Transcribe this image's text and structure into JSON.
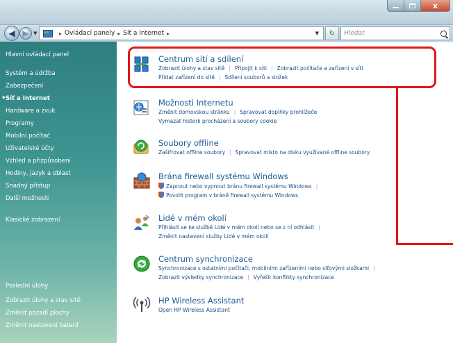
{
  "window": {
    "caption_buttons": {
      "minimize": "minimize",
      "maximize": "maximize",
      "close": "x"
    }
  },
  "navigation": {
    "address": {
      "segments": [
        "Ovládací panely",
        "Síť a Internet"
      ]
    },
    "search": {
      "placeholder": "Hledat"
    }
  },
  "sidebar": {
    "items": [
      {
        "label": "Hlavní ovládací panel"
      },
      {
        "label": "Systém a údržba"
      },
      {
        "label": "Zabezpečení"
      },
      {
        "label": "Síť a Internet",
        "current": true
      },
      {
        "label": "Hardware a zvuk"
      },
      {
        "label": "Programy"
      },
      {
        "label": "Mobilní počítač"
      },
      {
        "label": "Uživatelské účty"
      },
      {
        "label": "Vzhled a přizpůsobení"
      },
      {
        "label": "Hodiny, jazyk a oblast"
      },
      {
        "label": "Snadný přístup"
      },
      {
        "label": "Další možnosti"
      },
      {
        "label": "Klasické zobrazení"
      }
    ],
    "recent": {
      "heading": "Poslední úlohy",
      "items": [
        "Zobrazit úlohy a stav sítě",
        "Změnit pozadí plochy",
        "Změnit nastavení baterií"
      ]
    }
  },
  "categories": [
    {
      "title": "Centrum sítí a sdílení",
      "icon": "network-center-icon",
      "links": [
        [
          "Zobrazit úlohy a stav sítě",
          "Připojit k síti",
          "Zobrazit počítače a zařízení v síti"
        ],
        [
          "Přidat zařízení do sítě",
          "Sdílení souborů a složek"
        ]
      ]
    },
    {
      "title": "Možnosti Internetu",
      "icon": "internet-options-icon",
      "links": [
        [
          "Změnit domovskou stránku",
          "Spravovat doplňky prohlížeče"
        ],
        [
          "Vymazat historii procházení a soubory cookie"
        ]
      ]
    },
    {
      "title": "Soubory offline",
      "icon": "offline-files-icon",
      "links": [
        [
          "Zašifrovat offline soubory",
          "Spravovat místo na disku využívané offline soubory"
        ]
      ]
    },
    {
      "title": "Brána firewall systému Windows",
      "icon": "firewall-icon",
      "links": [
        [
          "Zapnout nebo vypnout bránu firewall systému Windows"
        ],
        [
          "Povolit program v bráně firewall systému Windows"
        ]
      ]
    },
    {
      "title": "Lidé v mém okolí",
      "icon": "people-near-me-icon",
      "links": [
        [
          "Přihlásit se ke službě Lidé v mém okolí nebo se z ní odhlásit"
        ],
        [
          "Změnit nastavení služby Lidé v mém okolí"
        ]
      ]
    },
    {
      "title": "Centrum synchronizace",
      "icon": "sync-center-icon",
      "links": [
        [
          "Synchronizace s ostatními počítači, mobilními zařízeními nebo síťovými složkami"
        ],
        [
          "Zobrazit výsledky synchronizace",
          "Vyřešit konflikty synchronizace"
        ]
      ]
    },
    {
      "title": "HP Wireless Assistant",
      "icon": "wireless-antenna-icon",
      "links": [
        [
          "Open HP Wireless Assistant"
        ]
      ]
    }
  ],
  "colors": {
    "highlight": "#e0161b",
    "link": "#1a4e86",
    "title_link": "#1e5a96"
  }
}
